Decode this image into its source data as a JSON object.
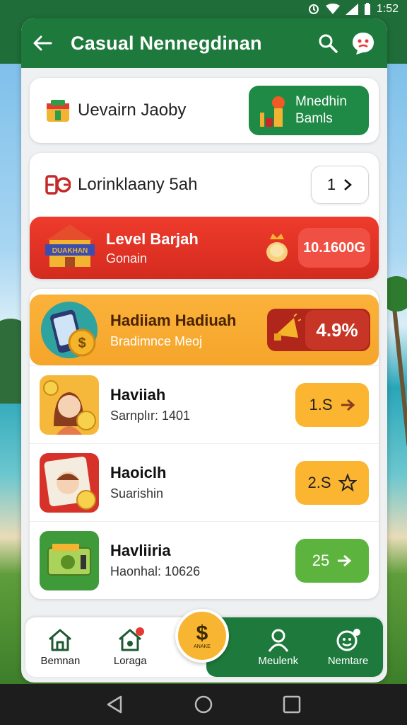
{
  "status_bar": {
    "time": "1:52"
  },
  "app_bar": {
    "title": "Casual Nennegdinan"
  },
  "card1": {
    "label": "Uevairn Jaoby",
    "pill_line1": "Mnedhin",
    "pill_line2": "Bamls"
  },
  "card2": {
    "label": "Lorinklaany 5ah",
    "button_value": "1",
    "banner_title": "Level Barjah",
    "banner_subtitle": "Gonain",
    "banner_value": "10.1600G",
    "banner_art_text": "DUAKHAN"
  },
  "promo": {
    "title": "Hadiiam Hadiuah",
    "subtitle": "Bradimnce Meoj",
    "percent": "4.9%"
  },
  "list": [
    {
      "title": "Haviiah",
      "subtitle": "Sarnplır: 1401",
      "button": "1.S",
      "style": "yellow"
    },
    {
      "title": "Haoiclh",
      "subtitle": "Suarishin",
      "button": "2.S",
      "style": "yellow"
    },
    {
      "title": "Havliiria",
      "subtitle": "Haonhal: 10626",
      "button": "25",
      "style": "green"
    }
  ],
  "bottom_nav": {
    "items": [
      "Bemnan",
      "Loraga",
      "Meulenk",
      "Nemtare"
    ],
    "fab_symbol": "$",
    "fab_sub": "ANAKE"
  },
  "colors": {
    "primary_green": "#1e7a3c",
    "accent_yellow": "#fbb531",
    "accent_red": "#e33a2c"
  }
}
